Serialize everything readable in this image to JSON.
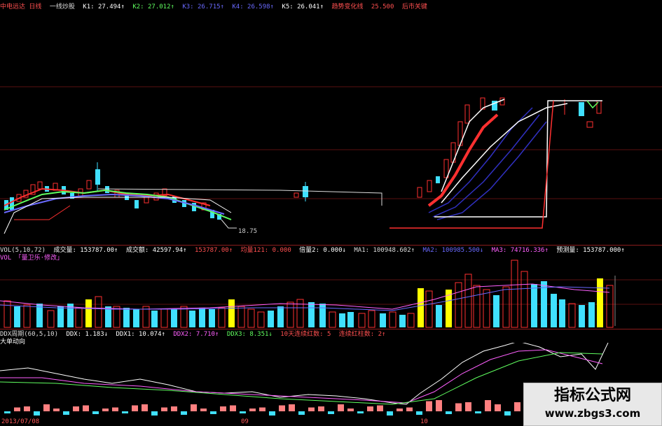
{
  "header": {
    "stock": "中电远达 日线",
    "mode": "一线炒股",
    "k1": "K1: 27.494↑",
    "k2": "K2: 27.012↑",
    "k3": "K3: 26.715↑",
    "k4": "K4: 26.598↑",
    "k5": "K5: 26.041↑",
    "trend_label": "趋势变化线",
    "trend_value": "25.500",
    "end_label": "后市关键"
  },
  "main_chart": {
    "low_label": "18.75"
  },
  "vol": {
    "title": "VOL(5,10,72)",
    "vol_amount": "成交量: 153787.00↑",
    "turnover": "成交额: 42597.94↑",
    "v3": "153787.00↑",
    "volume_ratio": "均量121: 0.000",
    "multiple": "倍量2: 0.000↓",
    "ma1": "MA1: 100948.602↑",
    "ma2": "MA2: 100985.500↓",
    "ma3": "MA3: 74716.336↑",
    "forecast": "预测量: 153787.000↑",
    "sub_title": "VOL 「量卫乐·修改」"
  },
  "ddx": {
    "title": "DDX周期(60,5,10)",
    "ddx": "DDX: 1.183↓",
    "ddx1": "DDX1: 10.074↑",
    "ddx2": "DDX2: 7.710↑",
    "ddx3": "DDX3: 8.351↓",
    "count1": "10天连续红数: 5",
    "count2": "连续红柱数: 2↑",
    "sub_title": "大单动向"
  },
  "axis": {
    "date1": "2013/07/08",
    "date2": "09",
    "date3": "10"
  },
  "watermark": {
    "cn": "指标公式网",
    "en": "www.zbgs3.com"
  },
  "colors": {
    "up": "#ff3030",
    "down": "#40e0ff",
    "highlight": "#ffff00",
    "grid": "#8a1c1c"
  }
}
